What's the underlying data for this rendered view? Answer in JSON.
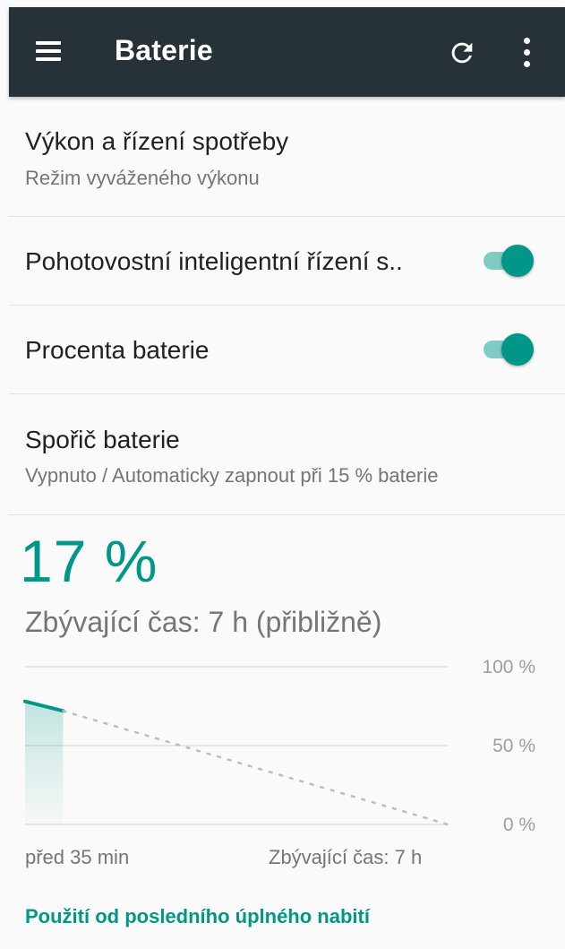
{
  "appbar": {
    "title": "Baterie",
    "icons": [
      "menu-icon",
      "refresh-icon",
      "more-vert-icon"
    ],
    "background": "#263238"
  },
  "settings": [
    {
      "title": "Výkon a řízení spotřeby",
      "subtitle": "Režim vyváženého výkonu"
    },
    {
      "title": "Pohotovostní inteligentní řízení s..",
      "toggle_on": true
    },
    {
      "title": "Procenta baterie",
      "toggle_on": true
    },
    {
      "title": "Spořič baterie",
      "subtitle": "Vypnuto / Automaticky zapnout při 15 % baterie"
    }
  ],
  "battery": {
    "percent_label": "17 %",
    "remaining_label": "Zbývající čas: 7 h (přibližně)"
  },
  "chart_data": {
    "type": "line",
    "y_tick_labels": [
      "100 %",
      "50 %",
      "0 %"
    ],
    "ylim": [
      0,
      100
    ],
    "x_start_label": "před 35 min",
    "x_end_label": "Zbývající čas: 7 h",
    "series": [
      {
        "kind": "history",
        "points": [
          {
            "t": 0,
            "v": 78
          },
          {
            "t": 0.09,
            "v": 72
          }
        ],
        "style": "solid"
      },
      {
        "kind": "projection",
        "points": [
          {
            "t": 0.09,
            "v": 72
          },
          {
            "t": 1,
            "v": 0
          }
        ],
        "style": "dotted"
      }
    ],
    "grid": true,
    "accent": "#009688"
  },
  "footer": {
    "link_label": "Použití od posledního úplného nabití"
  },
  "colors": {
    "accent": "#009688",
    "accent_light": "#80cbc4"
  }
}
